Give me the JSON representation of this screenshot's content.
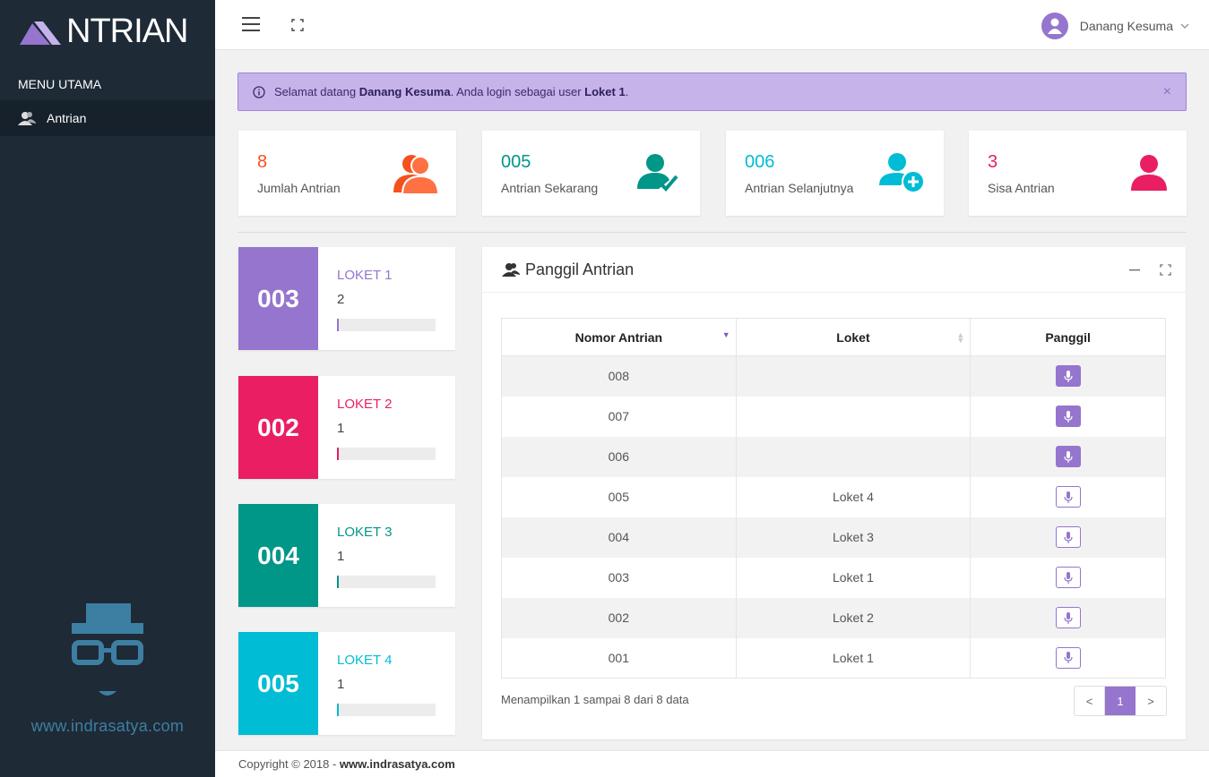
{
  "colors": {
    "sidebar": "#1e2a36",
    "accent": "#9575cd",
    "orange": "#f4511e",
    "teal": "#009688",
    "cyan": "#00bcd4",
    "pink": "#e91e63"
  },
  "sidebar": {
    "logo_text": "NTRIAN",
    "menu_header": "MENU UTAMA",
    "items": [
      {
        "label": "Antrian",
        "icon": "user-group-icon"
      }
    ],
    "brand_url": "www.indrasatya.com"
  },
  "topbar": {
    "user_name": "Danang Kesuma"
  },
  "alert": {
    "text_1": "Selamat datang ",
    "user": "Danang Kesuma",
    "text_2": ". Anda login sebagai user ",
    "loket": "Loket 1",
    "text_3": ".",
    "close": "×"
  },
  "stats": [
    {
      "value": "8",
      "label": "Jumlah Antrian",
      "icon": "users-icon"
    },
    {
      "value": "005",
      "label": "Antrian Sekarang",
      "icon": "user-check-icon"
    },
    {
      "value": "006",
      "label": "Antrian Selanjutnya",
      "icon": "user-plus-icon"
    },
    {
      "value": "3",
      "label": "Sisa Antrian",
      "icon": "user-icon"
    }
  ],
  "lokets": [
    {
      "number": "003",
      "name": "LOKET 1",
      "count": "2"
    },
    {
      "number": "002",
      "name": "LOKET 2",
      "count": "1"
    },
    {
      "number": "004",
      "name": "LOKET 3",
      "count": "1"
    },
    {
      "number": "005",
      "name": "LOKET 4",
      "count": "1"
    }
  ],
  "panel": {
    "title": "Panggil Antrian",
    "columns": [
      "Nomor Antrian",
      "Loket",
      "Panggil"
    ],
    "rows": [
      {
        "nomor": "008",
        "loket": "",
        "called": false
      },
      {
        "nomor": "007",
        "loket": "",
        "called": false
      },
      {
        "nomor": "006",
        "loket": "",
        "called": false
      },
      {
        "nomor": "005",
        "loket": "Loket 4",
        "called": true
      },
      {
        "nomor": "004",
        "loket": "Loket 3",
        "called": true
      },
      {
        "nomor": "003",
        "loket": "Loket 1",
        "called": true
      },
      {
        "nomor": "002",
        "loket": "Loket 2",
        "called": true
      },
      {
        "nomor": "001",
        "loket": "Loket 1",
        "called": true
      }
    ],
    "page_info": "Menampilkan 1 sampai 8 dari 8 data",
    "pager": {
      "prev": "<",
      "current": "1",
      "next": ">"
    }
  },
  "footer": {
    "text": "Copyright © 2018 - ",
    "link": "www.indrasatya.com"
  }
}
